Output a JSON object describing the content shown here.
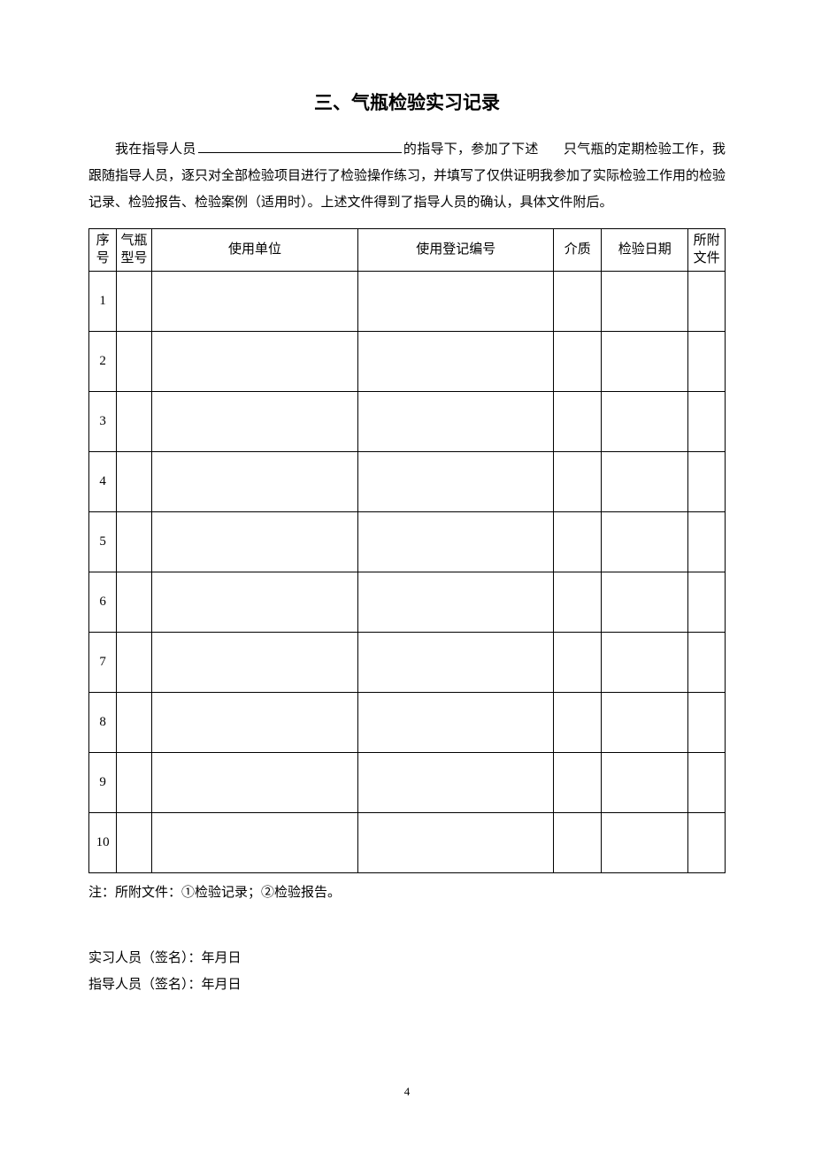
{
  "title": "三、气瓶检验实习记录",
  "intro": {
    "p1a": "我在指导人员",
    "p1b": "的指导下，参加了下述",
    "p1c": "只气瓶的定期检验工作，我跟随指导人员，逐只对全部检验项目进行了检验操作练习，并填写了仅供证明我参加了实际检验工作用的检验记录、检验报告、检验案例（适用时）。上述文件得到了指导人员的确认，具体文件附后。"
  },
  "headers": {
    "seq": "序号",
    "model": "气瓶型号",
    "unit": "使用单位",
    "reg": "使用登记编号",
    "medium": "介质",
    "date": "检验日期",
    "attach": "所附文件"
  },
  "rows": [
    {
      "seq": "1",
      "model": "",
      "unit": "",
      "reg": "",
      "medium": "",
      "date": "",
      "attach": ""
    },
    {
      "seq": "2",
      "model": "",
      "unit": "",
      "reg": "",
      "medium": "",
      "date": "",
      "attach": ""
    },
    {
      "seq": "3",
      "model": "",
      "unit": "",
      "reg": "",
      "medium": "",
      "date": "",
      "attach": ""
    },
    {
      "seq": "4",
      "model": "",
      "unit": "",
      "reg": "",
      "medium": "",
      "date": "",
      "attach": ""
    },
    {
      "seq": "5",
      "model": "",
      "unit": "",
      "reg": "",
      "medium": "",
      "date": "",
      "attach": ""
    },
    {
      "seq": "6",
      "model": "",
      "unit": "",
      "reg": "",
      "medium": "",
      "date": "",
      "attach": ""
    },
    {
      "seq": "7",
      "model": "",
      "unit": "",
      "reg": "",
      "medium": "",
      "date": "",
      "attach": ""
    },
    {
      "seq": "8",
      "model": "",
      "unit": "",
      "reg": "",
      "medium": "",
      "date": "",
      "attach": ""
    },
    {
      "seq": "9",
      "model": "",
      "unit": "",
      "reg": "",
      "medium": "",
      "date": "",
      "attach": ""
    },
    {
      "seq": "10",
      "model": "",
      "unit": "",
      "reg": "",
      "medium": "",
      "date": "",
      "attach": ""
    }
  ],
  "note": "注：所附文件：①检验记录；②检验报告。",
  "sign": {
    "trainee": "实习人员（签名）：年月日",
    "supervisor": "指导人员（签名）：年月日"
  },
  "pageNumber": "4"
}
